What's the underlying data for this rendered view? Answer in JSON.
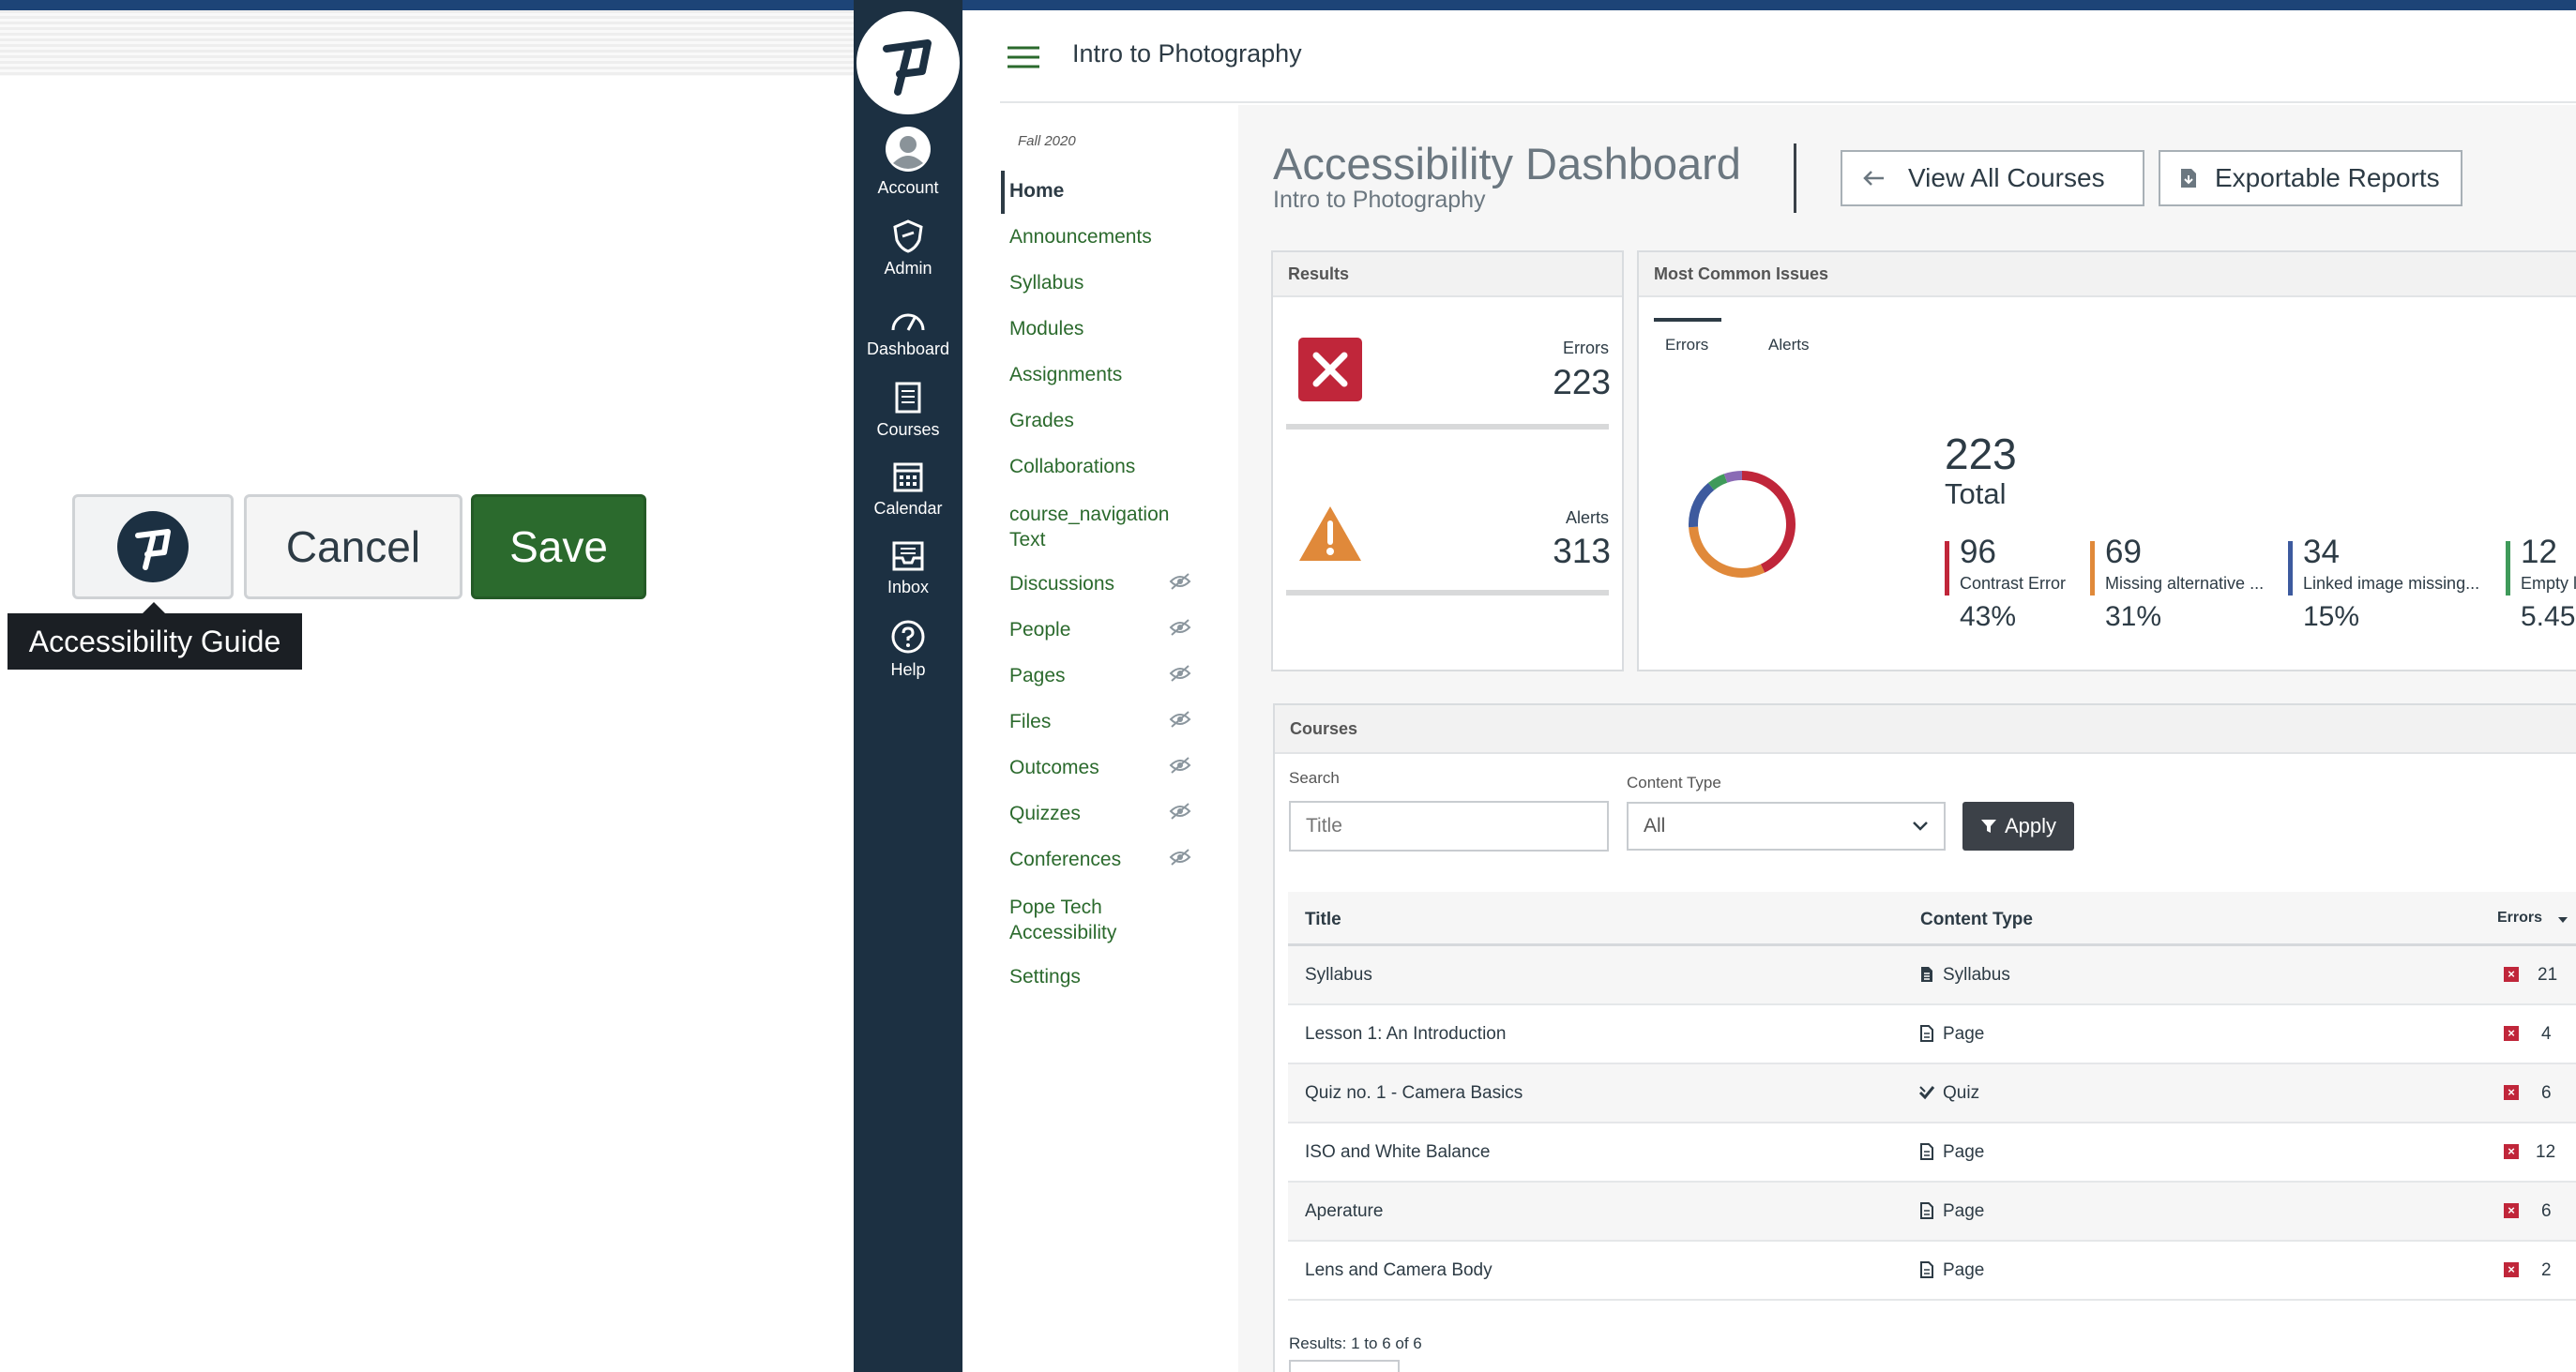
{
  "editor": {
    "guide_tooltip": "Accessibility Guide",
    "cancel_label": "Cancel",
    "save_label": "Save"
  },
  "global_nav": [
    {
      "label": "Account",
      "icon": "account-icon"
    },
    {
      "label": "Admin",
      "icon": "shield-icon"
    },
    {
      "label": "Dashboard",
      "icon": "dashboard-icon"
    },
    {
      "label": "Courses",
      "icon": "courses-icon"
    },
    {
      "label": "Calendar",
      "icon": "calendar-icon"
    },
    {
      "label": "Inbox",
      "icon": "inbox-icon"
    },
    {
      "label": "Help",
      "icon": "help-icon"
    }
  ],
  "course": {
    "title": "Intro to Photography",
    "term": "Fall 2020"
  },
  "course_nav": [
    {
      "label": "Home"
    },
    {
      "label": "Announcements"
    },
    {
      "label": "Syllabus"
    },
    {
      "label": "Modules"
    },
    {
      "label": "Assignments"
    },
    {
      "label": "Grades"
    },
    {
      "label": "Collaborations"
    },
    {
      "label": "course_navigation Text"
    },
    {
      "label": "Discussions",
      "hidden": true
    },
    {
      "label": "People",
      "hidden": true
    },
    {
      "label": "Pages",
      "hidden": true
    },
    {
      "label": "Files",
      "hidden": true
    },
    {
      "label": "Outcomes",
      "hidden": true
    },
    {
      "label": "Quizzes",
      "hidden": true
    },
    {
      "label": "Conferences",
      "hidden": true
    },
    {
      "label": "Pope Tech Accessibility"
    },
    {
      "label": "Settings"
    }
  ],
  "dashboard": {
    "title": "Accessibility Dashboard",
    "subtitle": "Intro to Photography",
    "view_all_label": "View All Courses",
    "reports_label": "Exportable Reports",
    "results": {
      "heading": "Results",
      "errors_label": "Errors",
      "errors_value": "223",
      "alerts_label": "Alerts",
      "alerts_value": "313"
    },
    "issues": {
      "heading": "Most Common Issues",
      "tab_errors": "Errors",
      "tab_alerts": "Alerts",
      "total_value": "223",
      "total_label": "Total",
      "items": [
        {
          "count": "96",
          "label": "Contrast Error",
          "percent": "43%",
          "color": "#c0263a"
        },
        {
          "count": "69",
          "label": "Missing alternative ...",
          "percent": "31%",
          "color": "#e0893a"
        },
        {
          "count": "34",
          "label": "Linked image missing...",
          "percent": "15%",
          "color": "#3d5a9e"
        },
        {
          "count": "12",
          "label": "Empty l",
          "percent": "5.45",
          "color": "#3f9a5a"
        }
      ]
    },
    "courses": {
      "heading": "Courses",
      "search_label": "Search",
      "search_placeholder": "Title",
      "content_type_label": "Content Type",
      "content_type_value": "All",
      "apply_label": "Apply",
      "columns": {
        "title": "Title",
        "type": "Content Type",
        "errors": "Errors"
      },
      "rows": [
        {
          "title": "Syllabus",
          "type": "Syllabus",
          "type_icon": "syllabus-icon",
          "errors": "21"
        },
        {
          "title": "Lesson 1: An Introduction",
          "type": "Page",
          "type_icon": "page-icon",
          "errors": "4"
        },
        {
          "title": "Quiz no. 1 - Camera Basics",
          "type": "Quiz",
          "type_icon": "quiz-icon",
          "errors": "6"
        },
        {
          "title": "ISO and White Balance",
          "type": "Page",
          "type_icon": "page-icon",
          "errors": "12"
        },
        {
          "title": "Aperature",
          "type": "Page",
          "type_icon": "page-icon",
          "errors": "6"
        },
        {
          "title": "Lens and Camera Body",
          "type": "Page",
          "type_icon": "page-icon",
          "errors": "2"
        }
      ],
      "results_text": "Results: 1 to 6 of 6"
    }
  },
  "colors": {
    "accent_green": "#2b6a2d",
    "nav_dark": "#1c3042",
    "error_red": "#c0263a",
    "alert_orange": "#e0893a"
  }
}
